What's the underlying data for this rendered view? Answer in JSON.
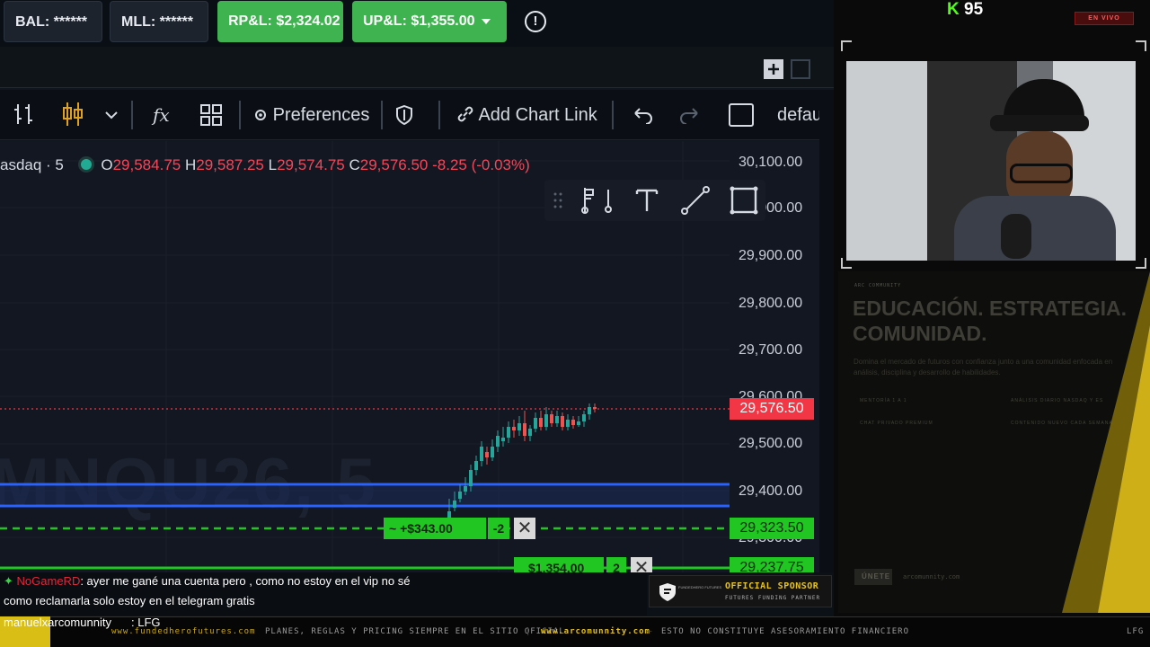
{
  "account": {
    "bal_label": "BAL: ******",
    "mll_label": "MLL: ******",
    "rpl_label": "RP&L: $2,324.02",
    "upl_label": "UP&L: $1,355.00",
    "warning_glyph": "!"
  },
  "toolbar": {
    "preferences_label": "Preferences",
    "add_chart_link_label": "Add Chart Link",
    "layout_label": "defau",
    "indicators_label": "fx"
  },
  "chart": {
    "symbol_label": "asdaq · 5",
    "ohlc": {
      "o_label": "O",
      "o": "29,584.75",
      "h_label": "H",
      "h": "29,587.25",
      "l_label": "L",
      "l": "29,574.75",
      "c_label": "C",
      "c": "29,576.50",
      "change": "-8.25 (-0.03%)"
    },
    "watermark": "MNQU26, 5",
    "price_labels": [
      "30,100.00",
      "30,000.00",
      "29,900.00",
      "29,800.00",
      "29,700.00",
      "29,600.00",
      "29,500.00",
      "29,400.00",
      "29,300.00"
    ],
    "last_price": "29,576.50",
    "order_prices": [
      "29,323.50",
      "29,237.75"
    ],
    "colors": {
      "up": "#26a69a",
      "down": "#ef5350",
      "last": "#f23645",
      "order": "#22c622",
      "level": "#2962ff"
    }
  },
  "orders": [
    {
      "pnl": "~ +$343.00",
      "qty": "-2",
      "close_glyph": "✕"
    },
    {
      "pnl": "$1,354.00",
      "qty": "2",
      "close_glyph": "✕"
    }
  ],
  "chat": {
    "line1_user": "NoGameRD",
    "line1_text": ": ayer me gané una cuenta pero , como no estoy en el vip no sé",
    "line2_text": "como reclamarla solo estoy en el telegram gratis",
    "line3_user": "manuelxarcomunnity",
    "line3_text": ": LFG"
  },
  "sponsor": {
    "title": "OFFICIAL SPONSOR",
    "subtitle": "FUTURES FUNDING PARTNER",
    "logo_text": "FUNDEDHERO FUTURES"
  },
  "ticker": {
    "item1": "www.fundedherofutures.com",
    "item2": "PLANES, REGLAS Y PRICING SIEMPRE EN EL SITIO OFICIAL",
    "item3": "www.arcomunnity.com",
    "item4": "ESTO NO CONSTITUYE ASESORAMIENTO FINANCIERO",
    "item5": "LFG"
  },
  "stream": {
    "viewer_count": "95",
    "live_badge": "EN VIVO"
  },
  "promo": {
    "eyebrow": "ARC COMMUNITY",
    "headline1": "EDUCACIÓN. ESTRATEGIA.",
    "headline2": "COMUNIDAD.",
    "body": "Domina el mercado de futuros con confianza junto a una comunidad enfocada en análisis, disciplina y desarrollo de habilidades.",
    "features": [
      "MENTORÍA 1 A 1",
      "ANÁLISIS DIARIO NASDAQ Y ES",
      "CHAT PRIVADO PREMIUM",
      "CONTENIDO NUEVO CADA SEMANA"
    ],
    "cta": "ÚNETE",
    "url": "arcomunnity.com"
  }
}
